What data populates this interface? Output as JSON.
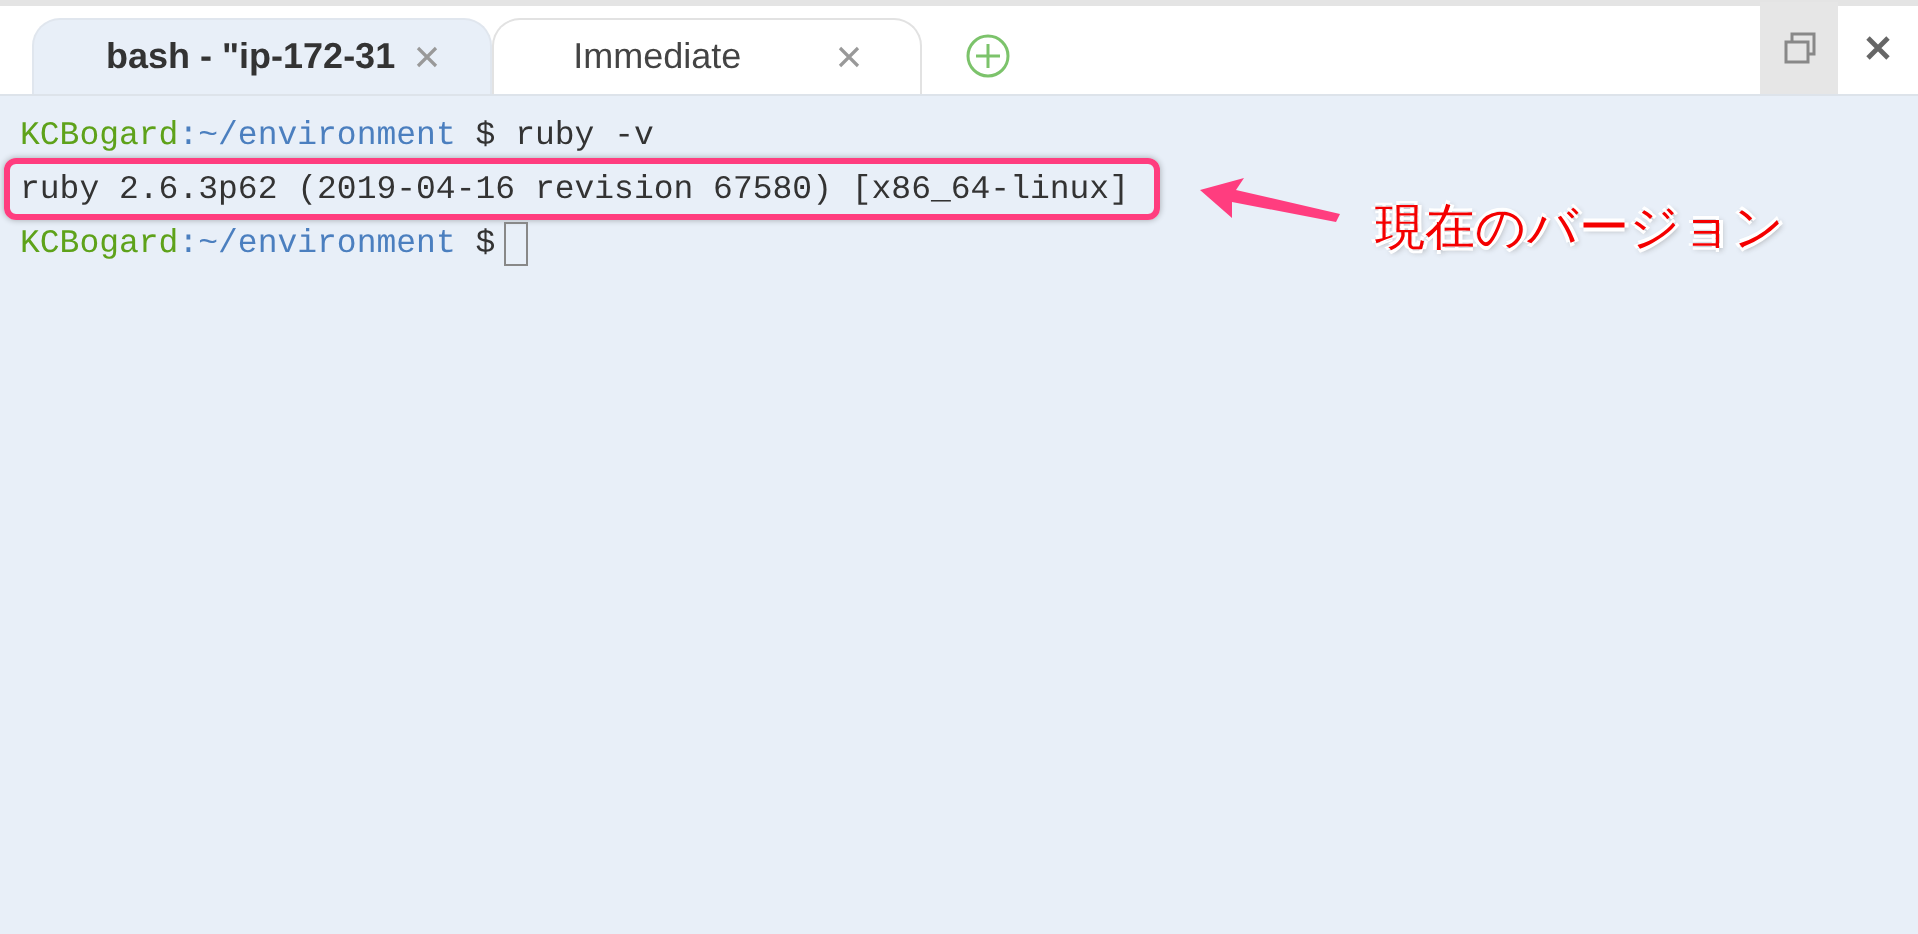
{
  "tabs": [
    {
      "label": "bash - \"ip-172-31",
      "selected": true
    },
    {
      "label": "Immediate",
      "selected": false
    }
  ],
  "terminal": {
    "lines": [
      {
        "kind": "prompt",
        "user": "KCBogard",
        "path": ":~/environment",
        "symbol": "$",
        "command": "ruby -v",
        "cursor": false
      },
      {
        "kind": "output",
        "text": "ruby 2.6.3p62 (2019-04-16 revision 67580) [x86_64-linux]",
        "highlighted": true
      },
      {
        "kind": "prompt",
        "user": "KCBogard",
        "path": ":~/environment",
        "symbol": "$",
        "cursor": true
      }
    ]
  },
  "annotation": {
    "label": "現在のバージョン"
  }
}
